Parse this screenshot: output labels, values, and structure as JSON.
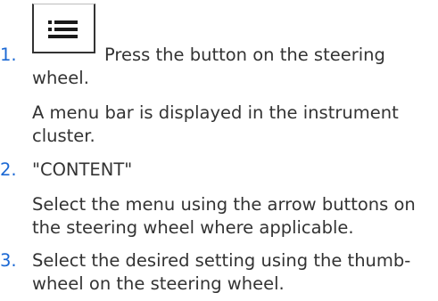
{
  "steps": [
    {
      "number": "1.",
      "line1": "Press the button on the steering",
      "line2": "wheel.",
      "note_line1": "A menu bar is displayed in the instrument",
      "note_line2": "cluster."
    },
    {
      "number": "2.",
      "line1": "\"CONTENT\"",
      "note_line1": "Select the menu using the arrow buttons on",
      "note_line2": "the steering wheel where applicable."
    },
    {
      "number": "3.",
      "line1": "Select the desired setting using the thumb-",
      "line2": "wheel on the steering wheel."
    }
  ],
  "icons": {
    "step1": "menu-list-icon"
  },
  "colors": {
    "number": "#1c69d4",
    "text": "#333333"
  }
}
